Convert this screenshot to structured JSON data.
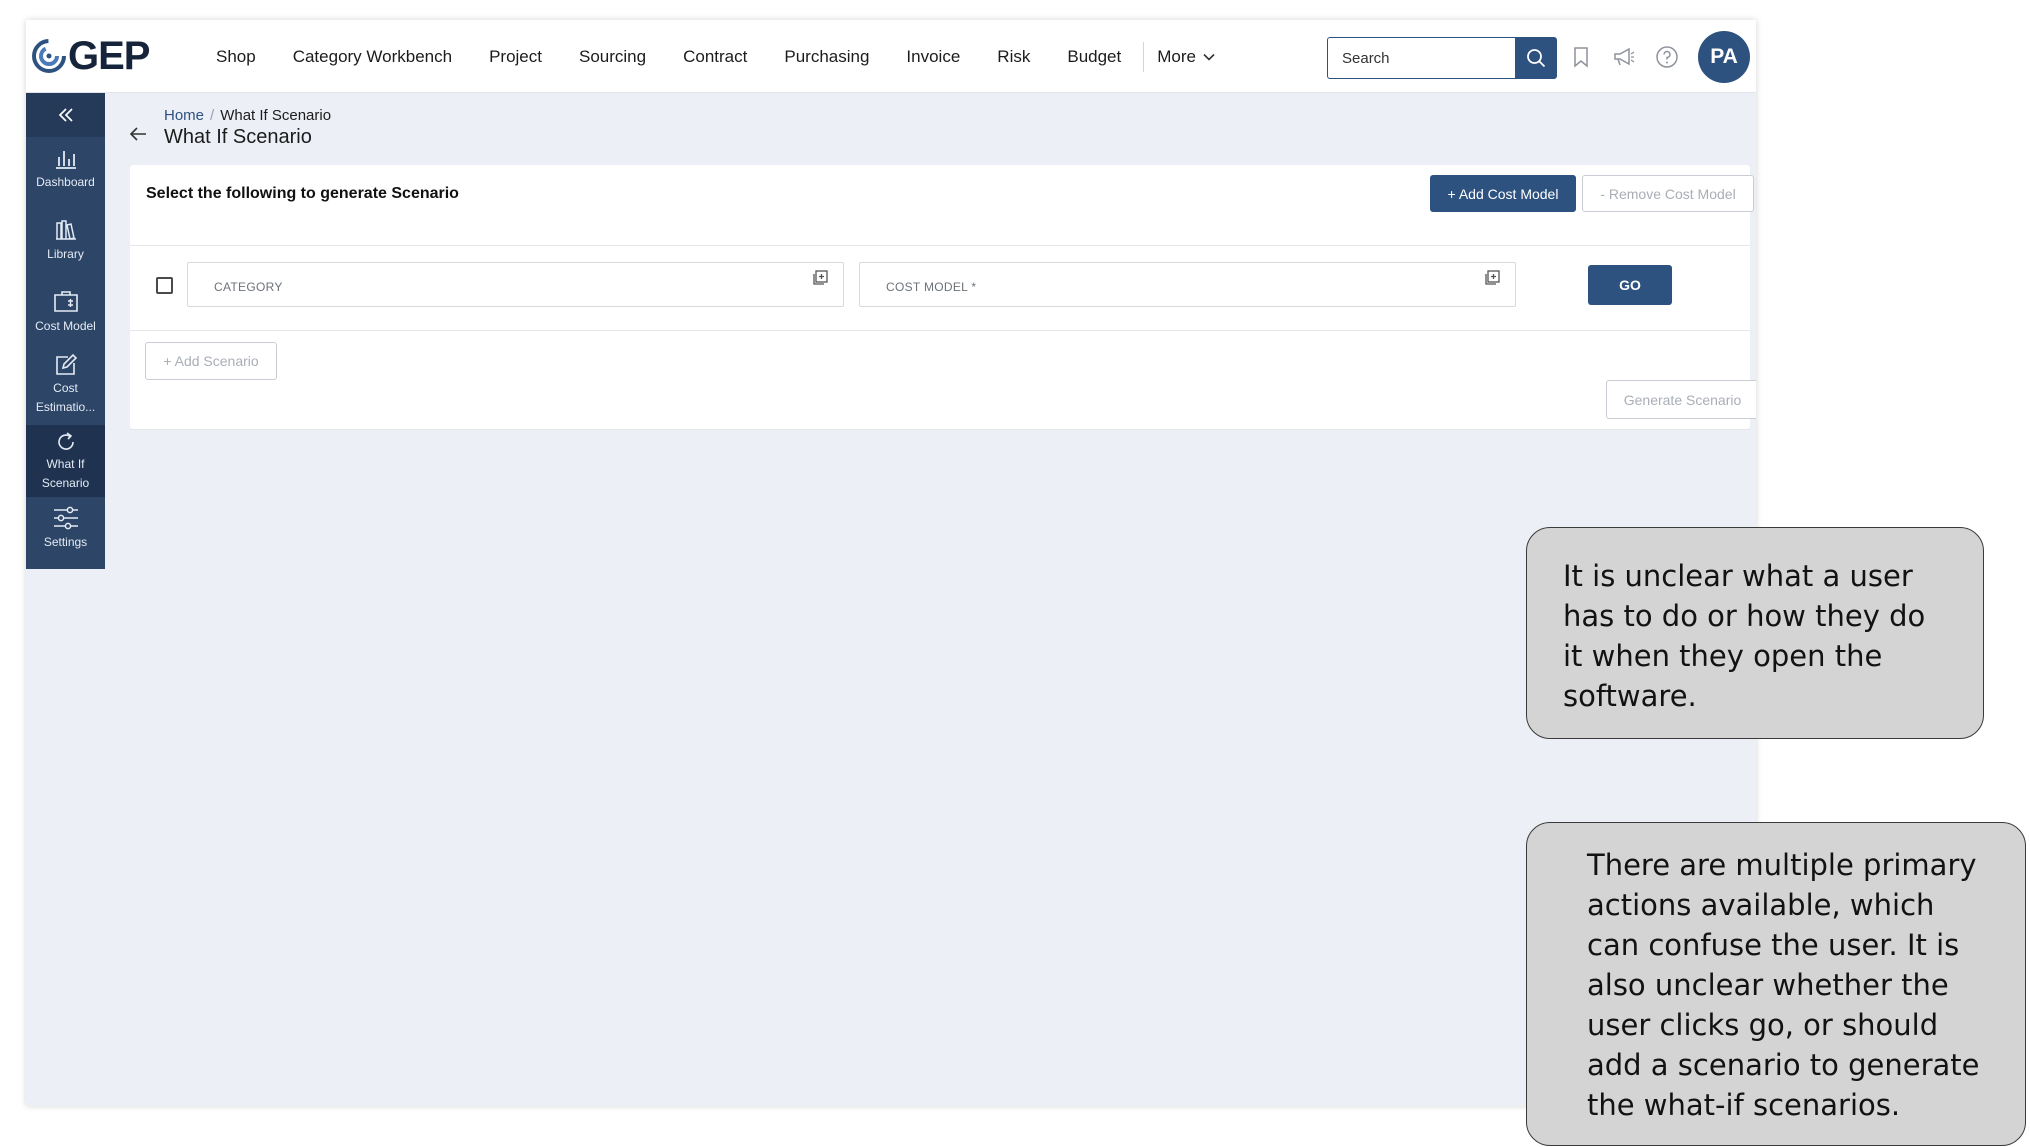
{
  "app": {
    "logo_text": "GEP",
    "nav": [
      "Shop",
      "Category Workbench",
      "Project",
      "Sourcing",
      "Contract",
      "Purchasing",
      "Invoice",
      "Risk",
      "Budget"
    ],
    "more_label": "More",
    "search_placeholder": "Search",
    "avatar_initials": "PA"
  },
  "sidebar": {
    "items": [
      {
        "label": "Dashboard",
        "icon": "bar-chart-icon"
      },
      {
        "label": "Library",
        "icon": "books-icon"
      },
      {
        "label": "Cost Model",
        "icon": "cost-model-icon"
      },
      {
        "label": "Cost Estimatio...",
        "icon": "edit-icon"
      },
      {
        "label": "What If Scenario",
        "icon": "refresh-icon",
        "active": true
      },
      {
        "label": "Settings",
        "icon": "sliders-icon"
      }
    ]
  },
  "page": {
    "breadcrumb_home": "Home",
    "breadcrumb_separator": "/",
    "breadcrumb_current": "What If Scenario",
    "title": "What If Scenario"
  },
  "card": {
    "title": "Select the following to generate Scenario",
    "add_cost_model": "+ Add Cost Model",
    "remove_cost_model": "- Remove Cost Model",
    "category_label": "CATEGORY",
    "cost_model_label": "COST MODEL *",
    "go_label": "GO",
    "add_scenario": "+ Add Scenario",
    "generate_scenario": "Generate Scenario"
  },
  "annotations": {
    "note1": "It is unclear what a user has to do or how they do it when they open the software.",
    "note2": "There are multiple primary actions available, which can confuse the user. It is also unclear whether the user clicks go, or should add a scenario to generate the what-if scenarios."
  },
  "colors": {
    "primary": "#2d527f",
    "sidebar": "#2d4566",
    "page_bg": "#eceff6",
    "note_bg": "#d4d4d4"
  }
}
